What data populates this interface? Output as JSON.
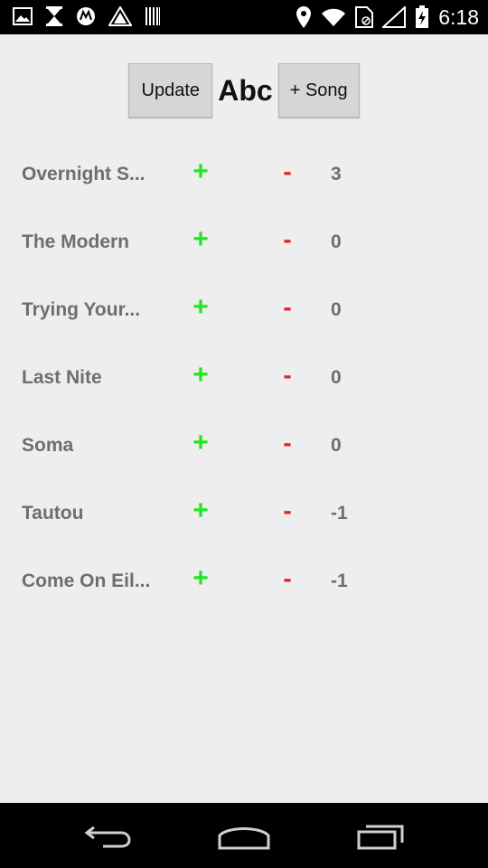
{
  "status_bar": {
    "time": "6:18",
    "left_icons": [
      "image-icon",
      "hourglass-icon",
      "motorola-icon",
      "warning-triangle-icon",
      "barcode-icon"
    ],
    "right_icons": [
      "location-pin-icon",
      "wifi-icon",
      "sim-card-icon",
      "signal-icon",
      "battery-charging-icon"
    ]
  },
  "header": {
    "update_label": "Update",
    "title": "Abc",
    "add_song_label": "+ Song"
  },
  "songs": [
    {
      "name": "Overnight S...",
      "plus": "+",
      "minus": "-",
      "score": "3"
    },
    {
      "name": "The Modern",
      "plus": "+",
      "minus": "-",
      "score": "0"
    },
    {
      "name": "Trying Your...",
      "plus": "+",
      "minus": "-",
      "score": "0"
    },
    {
      "name": "Last Nite",
      "plus": "+",
      "minus": "-",
      "score": "0"
    },
    {
      "name": "Soma",
      "plus": "+",
      "minus": "-",
      "score": "0"
    },
    {
      "name": "Tautou",
      "plus": "+",
      "minus": "-",
      "score": "-1"
    },
    {
      "name": "Come On Eil...",
      "plus": "+",
      "minus": "-",
      "score": "-1"
    }
  ],
  "nav_bar": {
    "icons": [
      "back-icon",
      "home-icon",
      "recent-apps-icon"
    ]
  },
  "colors": {
    "plus": "#22e622",
    "minus": "#e62222",
    "text_gray": "#6e6e6e",
    "background": "#eeeeee"
  }
}
